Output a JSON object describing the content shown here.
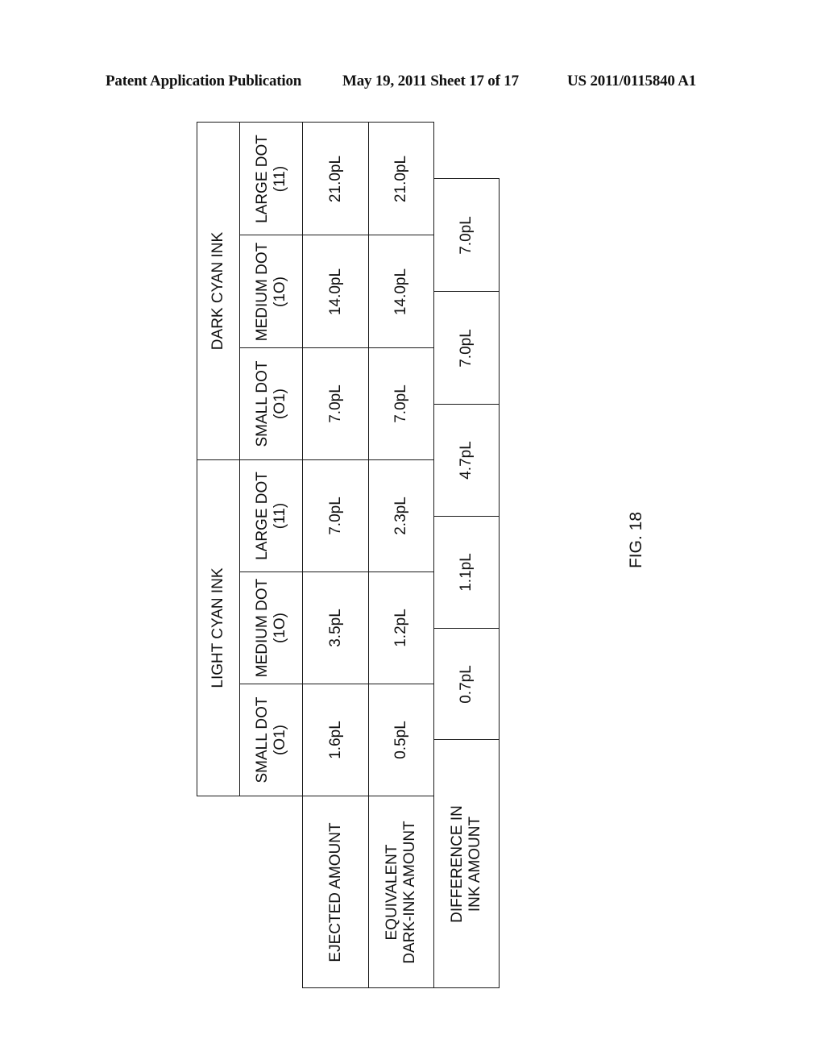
{
  "page_header": {
    "left": "Patent Application Publication",
    "center": "May 19, 2011  Sheet 17 of 17",
    "right": "US 2011/0115840 A1"
  },
  "figure_label": "FIG. 18",
  "table": {
    "ink_groups": [
      {
        "name": "LIGHT CYAN INK",
        "dots": [
          {
            "label": "SMALL DOT",
            "code": "(O1)",
            "ejected": "1.6pL",
            "equivalent": "0.5pL"
          },
          {
            "label": "MEDIUM DOT",
            "code": "(1O)",
            "ejected": "3.5pL",
            "equivalent": "1.2pL"
          },
          {
            "label": "LARGE DOT",
            "code": "(11)",
            "ejected": "7.0pL",
            "equivalent": "2.3pL"
          }
        ]
      },
      {
        "name": "DARK CYAN INK",
        "dots": [
          {
            "label": "SMALL DOT",
            "code": "(O1)",
            "ejected": "7.0pL",
            "equivalent": "7.0pL"
          },
          {
            "label": "MEDIUM DOT",
            "code": "(1O)",
            "ejected": "14.0pL",
            "equivalent": "14.0pL"
          },
          {
            "label": "LARGE DOT",
            "code": "(11)",
            "ejected": "21.0pL",
            "equivalent": "21.0pL"
          }
        ]
      }
    ],
    "row_headers": {
      "ejected": "EJECTED AMOUNT",
      "equivalent_line1": "EQUIVALENT",
      "equivalent_line2": "DARK-INK AMOUNT",
      "difference_line1": "DIFFERENCE IN",
      "difference_line2": "INK AMOUNT"
    },
    "differences": [
      "0.7pL",
      "1.1pL",
      "4.7pL",
      "7.0pL",
      "7.0pL"
    ]
  }
}
